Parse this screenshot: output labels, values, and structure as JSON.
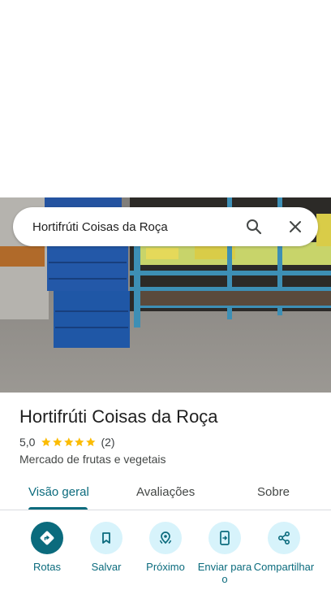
{
  "search": {
    "query": "Hortifrúti Coisas da Roça"
  },
  "place": {
    "name": "Hortifrúti Coisas da Roça",
    "rating": "5,0",
    "stars": 5,
    "review_count": "(2)",
    "category": "Mercado de frutas e vegetais"
  },
  "tabs": [
    {
      "label": "Visão geral"
    },
    {
      "label": "Avaliações"
    },
    {
      "label": "Sobre"
    }
  ],
  "actions": [
    {
      "label": "Rotas",
      "icon": "directions-icon"
    },
    {
      "label": "Salvar",
      "icon": "bookmark-icon"
    },
    {
      "label": "Próximo",
      "icon": "nearby-icon"
    },
    {
      "label": "Enviar para o",
      "icon": "send-to-phone-icon"
    },
    {
      "label": "Compartilhar",
      "icon": "share-icon"
    }
  ],
  "colors": {
    "accent": "#0b6b7d",
    "action_bg": "#d7f3fb",
    "star": "#fbbc04"
  }
}
